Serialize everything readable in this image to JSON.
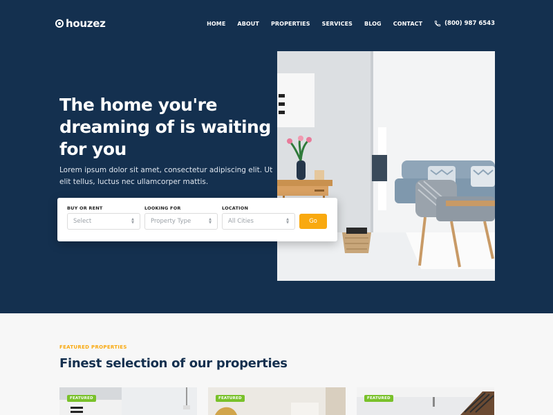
{
  "brand": {
    "name": "houzez"
  },
  "nav": {
    "items": [
      "HOME",
      "ABOUT",
      "PROPERTIES",
      "SERVICES",
      "BLOG",
      "CONTACT"
    ],
    "phone": "(800) 987 6543"
  },
  "hero": {
    "title": "The home you're dreaming of is waiting for you",
    "subtitle": "Lorem ipsum dolor sit amet, consectetur adipiscing elit. Ut elit tellus, luctus nec ullamcorper mattis."
  },
  "search": {
    "buy_or_rent": {
      "label": "BUY OR RENT",
      "value": "Select"
    },
    "looking_for": {
      "label": "LOOKING FOR",
      "value": "Property Type"
    },
    "location": {
      "label": "LOCATION",
      "value": "All Cities"
    },
    "button": "Go"
  },
  "featured": {
    "eyebrow": "FEATURED PROPERTIES",
    "title": "Finest selection of our properties",
    "cards": [
      {
        "badge": "FEATURED"
      },
      {
        "badge": "FEATURED"
      },
      {
        "badge": "FEATURED"
      }
    ]
  },
  "colors": {
    "hero_bg": "#14304f",
    "accent": "#f9a90f",
    "badge": "#79c12a"
  },
  "icons": [
    "logo-pin-icon",
    "phone-icon",
    "select-arrows-icon"
  ]
}
